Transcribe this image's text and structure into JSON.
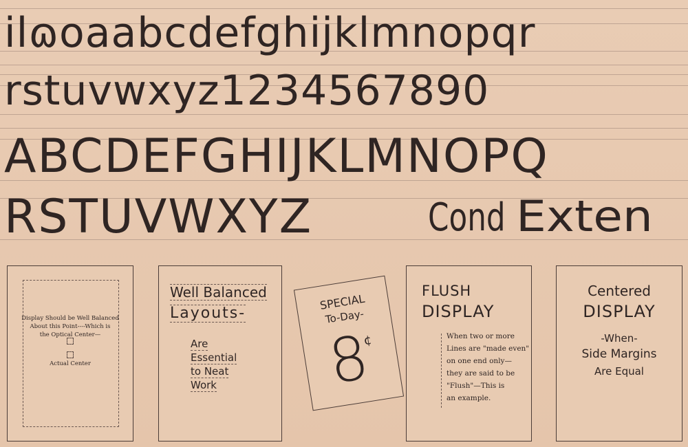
{
  "rows": {
    "lower1": "ilɷoaabcdefghijklmnopqr",
    "lower2": "rstuvwxyz1234567890",
    "upper1": "ABCDEFGHIJKLMNOPQ",
    "upper2": "RSTUVWXYZ",
    "cond": "Cond",
    "exten": "Exten"
  },
  "panels": {
    "optical": {
      "line1": "Display Should be Well Balanced",
      "line2": "About this Point----Which is",
      "line3": "the Optical Center—",
      "actual": "Actual Center"
    },
    "balanced": {
      "line1": "Well Balanced",
      "line2": "Layouts-",
      "w1": "Are",
      "w2": "Essential",
      "w3": "to Neat",
      "w4": "Work"
    },
    "special": {
      "line1": "SPECIAL",
      "line2": "To-Day-",
      "price": "8",
      "cent": "¢"
    },
    "flush": {
      "line1": "FLUSH",
      "line2": "DISPLAY",
      "b1": "When two or more",
      "b2": "Lines are \"made even\"",
      "b3": "on one end only—",
      "b4": "they are said to be",
      "b5": "\"Flush\"—This is",
      "b6": "an example."
    },
    "centered": {
      "line1": "Centered",
      "line2": "DISPLAY",
      "line3": "-When-",
      "line4": "Side Margins",
      "line5": "Are Equal"
    }
  }
}
